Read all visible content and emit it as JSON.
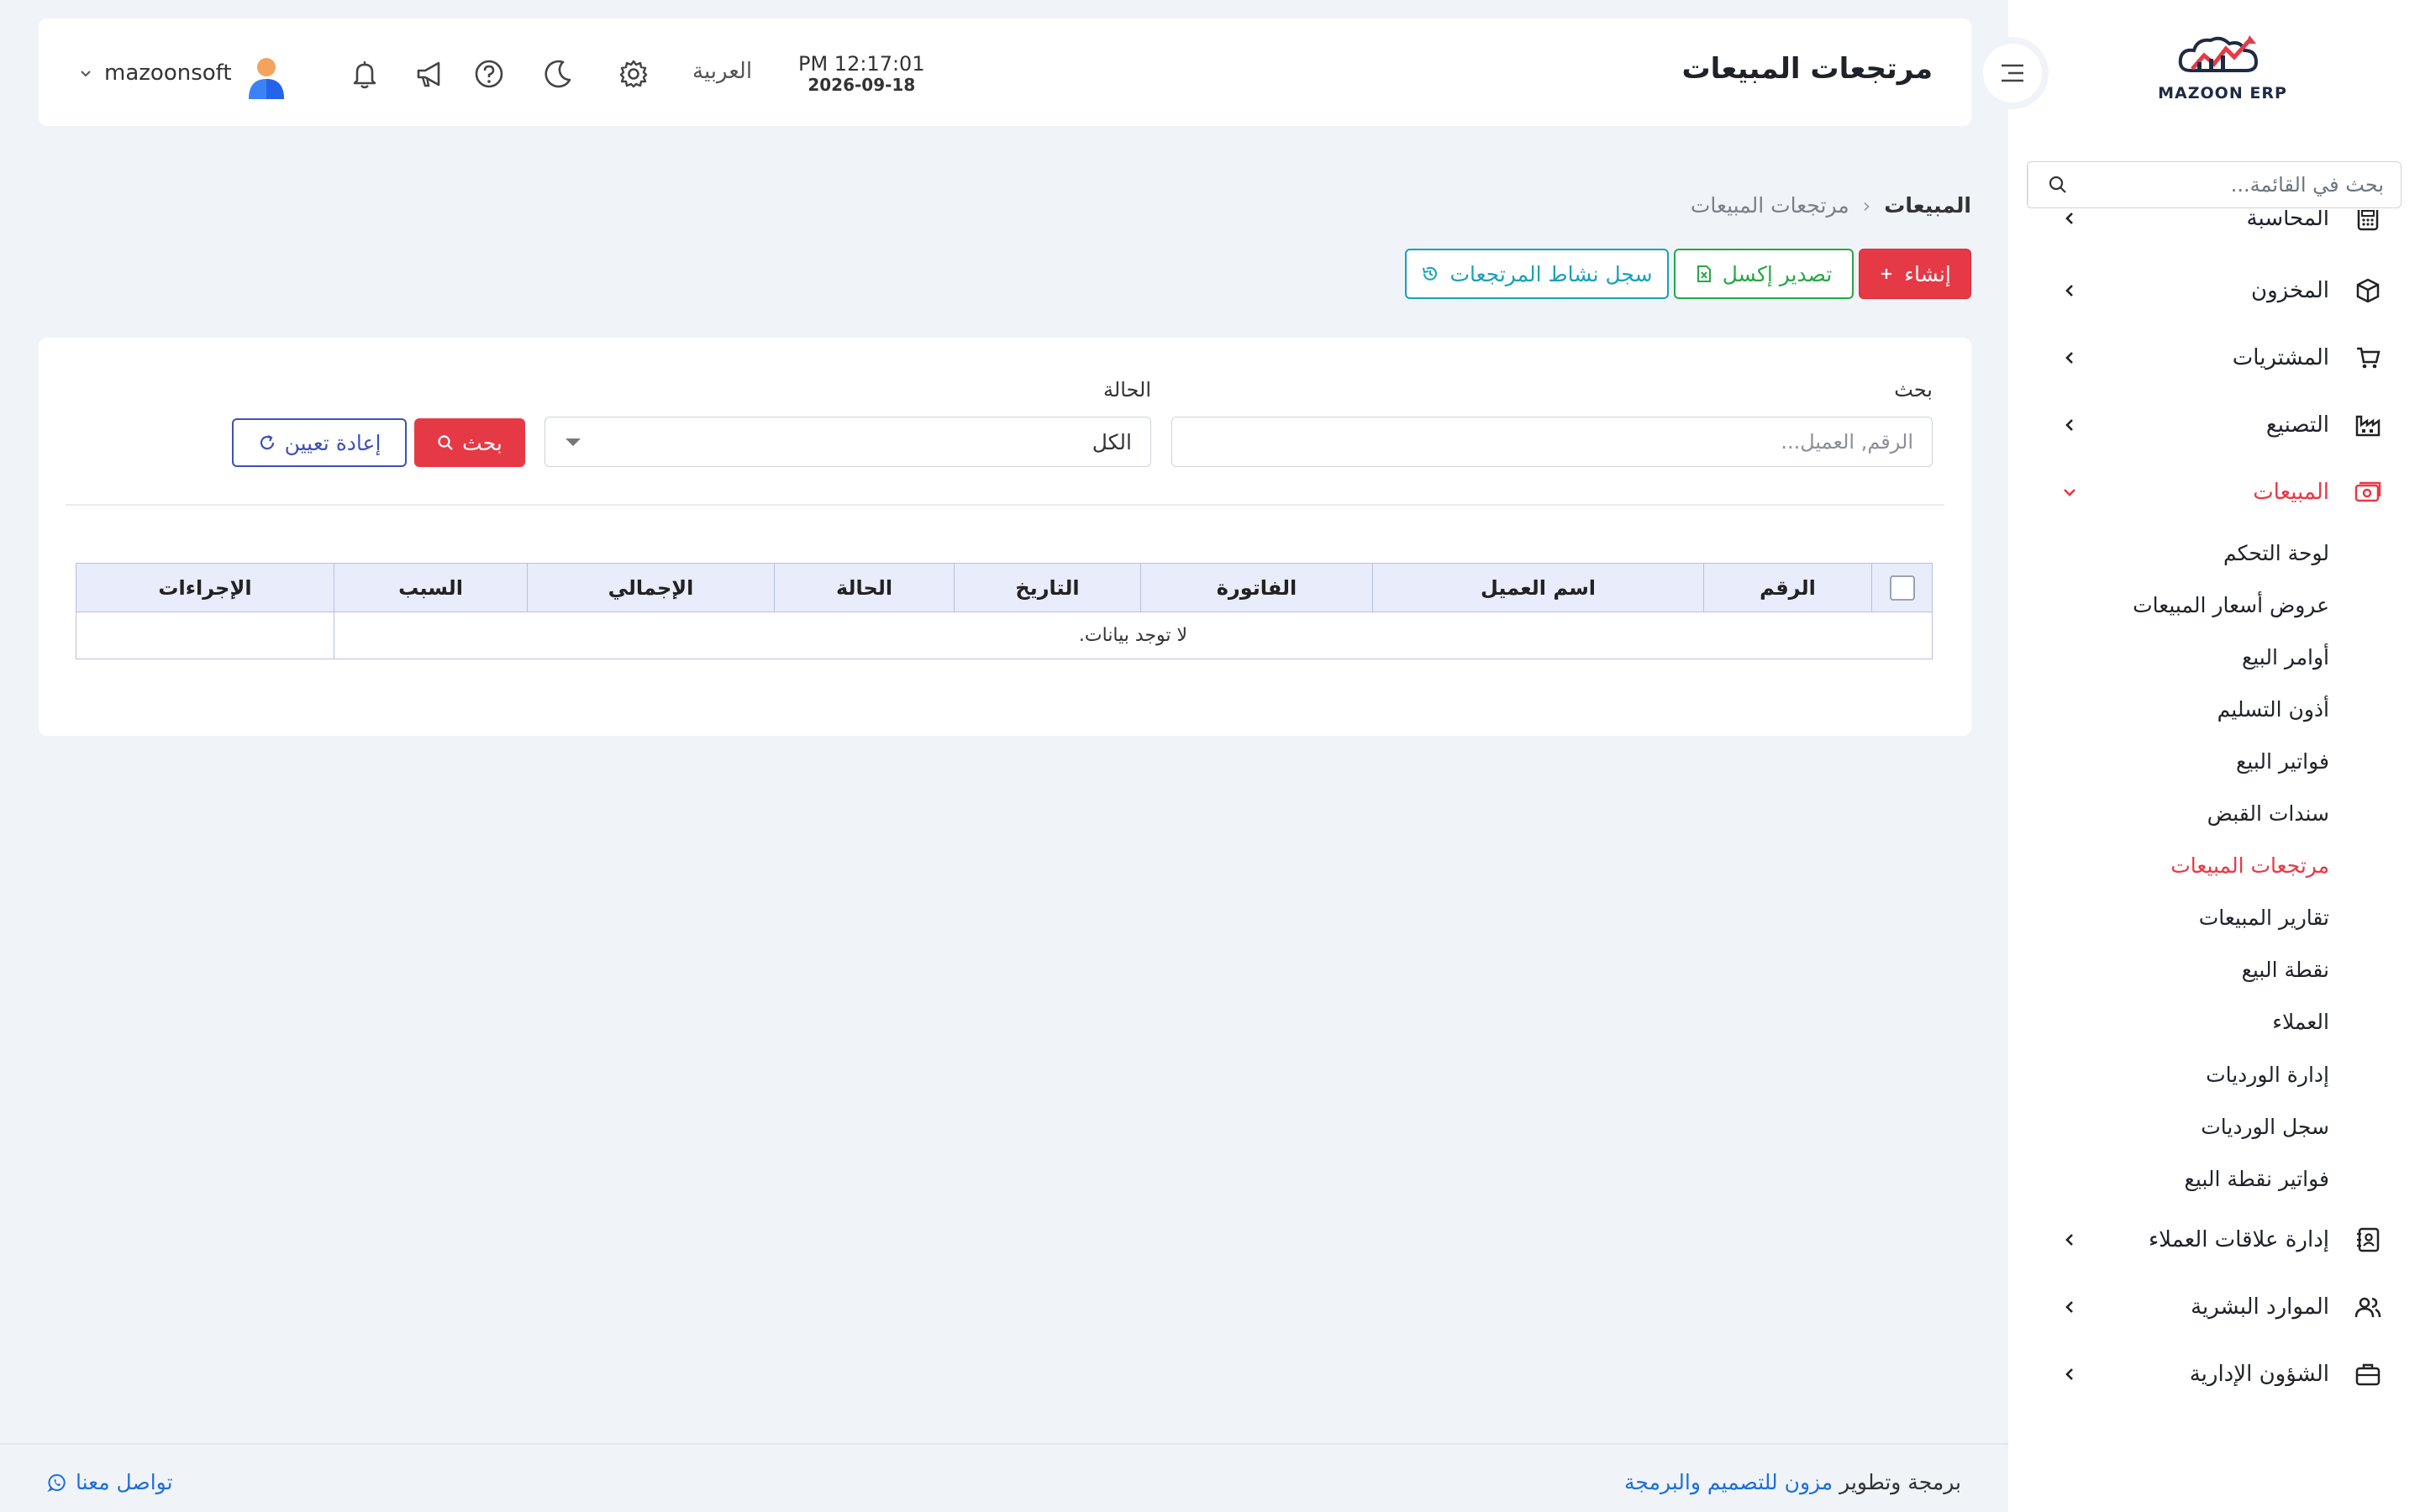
{
  "sidebar": {
    "logo_text": "MAZOON ERP",
    "search_placeholder": "بحث في القائمة...",
    "items": [
      {
        "label": "المحاسبة",
        "icon": "calculator-icon"
      },
      {
        "label": "المخزون",
        "icon": "box-icon"
      },
      {
        "label": "المشتريات",
        "icon": "cart-icon"
      },
      {
        "label": "التصنيع",
        "icon": "factory-icon"
      },
      {
        "label": "المبيعات",
        "icon": "money-icon"
      },
      {
        "label": "إدارة علاقات العملاء",
        "icon": "contacts-icon"
      },
      {
        "label": "الموارد البشرية",
        "icon": "users-icon"
      },
      {
        "label": "الشؤون الإدارية",
        "icon": "briefcase-icon"
      }
    ],
    "sales_sub": [
      "لوحة التحكم",
      "عروض أسعار المبيعات",
      "أوامر البيع",
      "أذون التسليم",
      "فواتير البيع",
      "سندات القبض",
      "مرتجعات المبيعات",
      "تقارير المبيعات",
      "نقطة البيع",
      "العملاء",
      "إدارة الورديات",
      "سجل الورديات",
      "فواتير نقطة البيع"
    ]
  },
  "header": {
    "title": "مرتجعات المبيعات",
    "time": "PM 12:17:01",
    "date": "2026-09-18",
    "language": "العربية",
    "username": "mazoonsoft"
  },
  "breadcrumb": {
    "root": "المبيعات",
    "separator": "‹",
    "current": "مرتجعات المبيعات"
  },
  "actions": {
    "create": "إنشاء",
    "export_excel": "تصدير إكسل",
    "activity_log": "سجل نشاط المرتجعات"
  },
  "filters": {
    "search_label": "بحث",
    "search_placeholder": "الرقم, العميل...",
    "status_label": "الحالة",
    "status_value": "الكل",
    "search_button": "بحث",
    "reset_button": "إعادة تعيين"
  },
  "table": {
    "headers": [
      "الرقم",
      "اسم العميل",
      "الفاتورة",
      "التاريخ",
      "الحالة",
      "الإجمالي",
      "السبب",
      "الإجراءات"
    ],
    "empty": "لا توجد بيانات."
  },
  "footer": {
    "credit_prefix": "برمجة وتطوير",
    "credit_brand": "مزون للتصميم والبرمجة",
    "contact": "تواصل معنا"
  },
  "colors": {
    "primary": "#e63946",
    "success": "#28a745",
    "info": "#17a2b8",
    "indigo": "#3f51b5",
    "link": "#1e6fd9"
  }
}
